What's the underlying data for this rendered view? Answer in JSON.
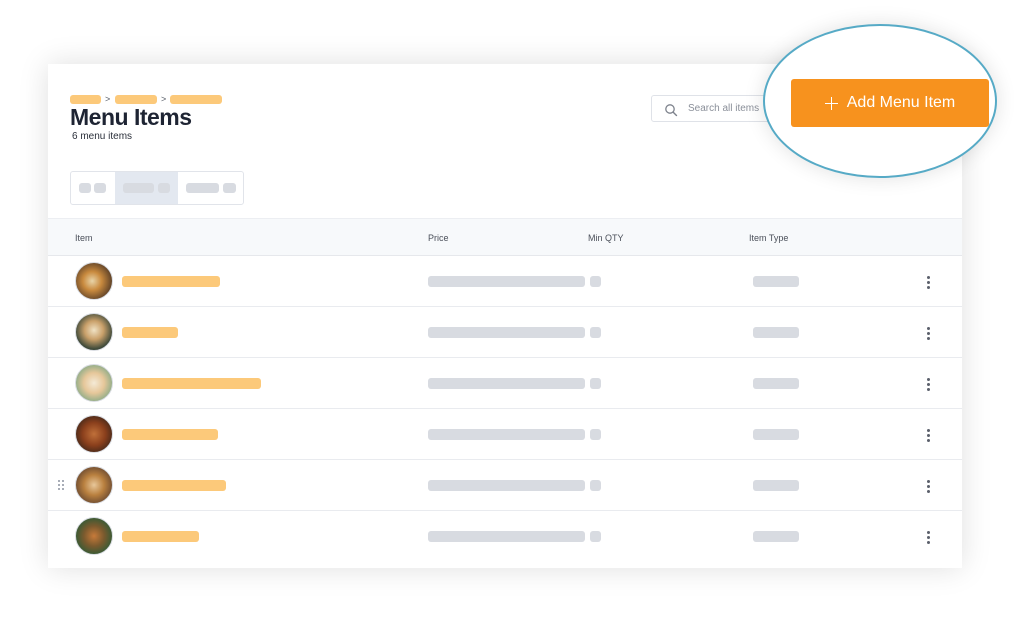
{
  "header": {
    "title": "Menu Items",
    "item_count": "6 menu items",
    "breadcrumb_separators": [
      ">",
      ">"
    ]
  },
  "search": {
    "placeholder": "Search all items"
  },
  "actions": {
    "add_label": "Add Menu Item"
  },
  "table": {
    "columns": [
      "Item",
      "Price",
      "Min QTY",
      "Item Type"
    ],
    "rows": [
      {
        "image": "food-thumbnail"
      },
      {
        "image": "food-thumbnail"
      },
      {
        "image": "food-thumbnail"
      },
      {
        "image": "food-thumbnail"
      },
      {
        "image": "food-thumbnail"
      },
      {
        "image": "food-thumbnail"
      }
    ]
  },
  "icons": {
    "search": "search-icon",
    "add": "plus-icon",
    "row_menu": "more-vertical-icon",
    "drag": "drag-handle-icon"
  },
  "colors": {
    "accent": "#f7921e",
    "placeholder_orange": "#fcc97a",
    "placeholder_gray": "#d8dbe1",
    "highlight_ring": "#56aac6",
    "title": "#1e2433"
  }
}
